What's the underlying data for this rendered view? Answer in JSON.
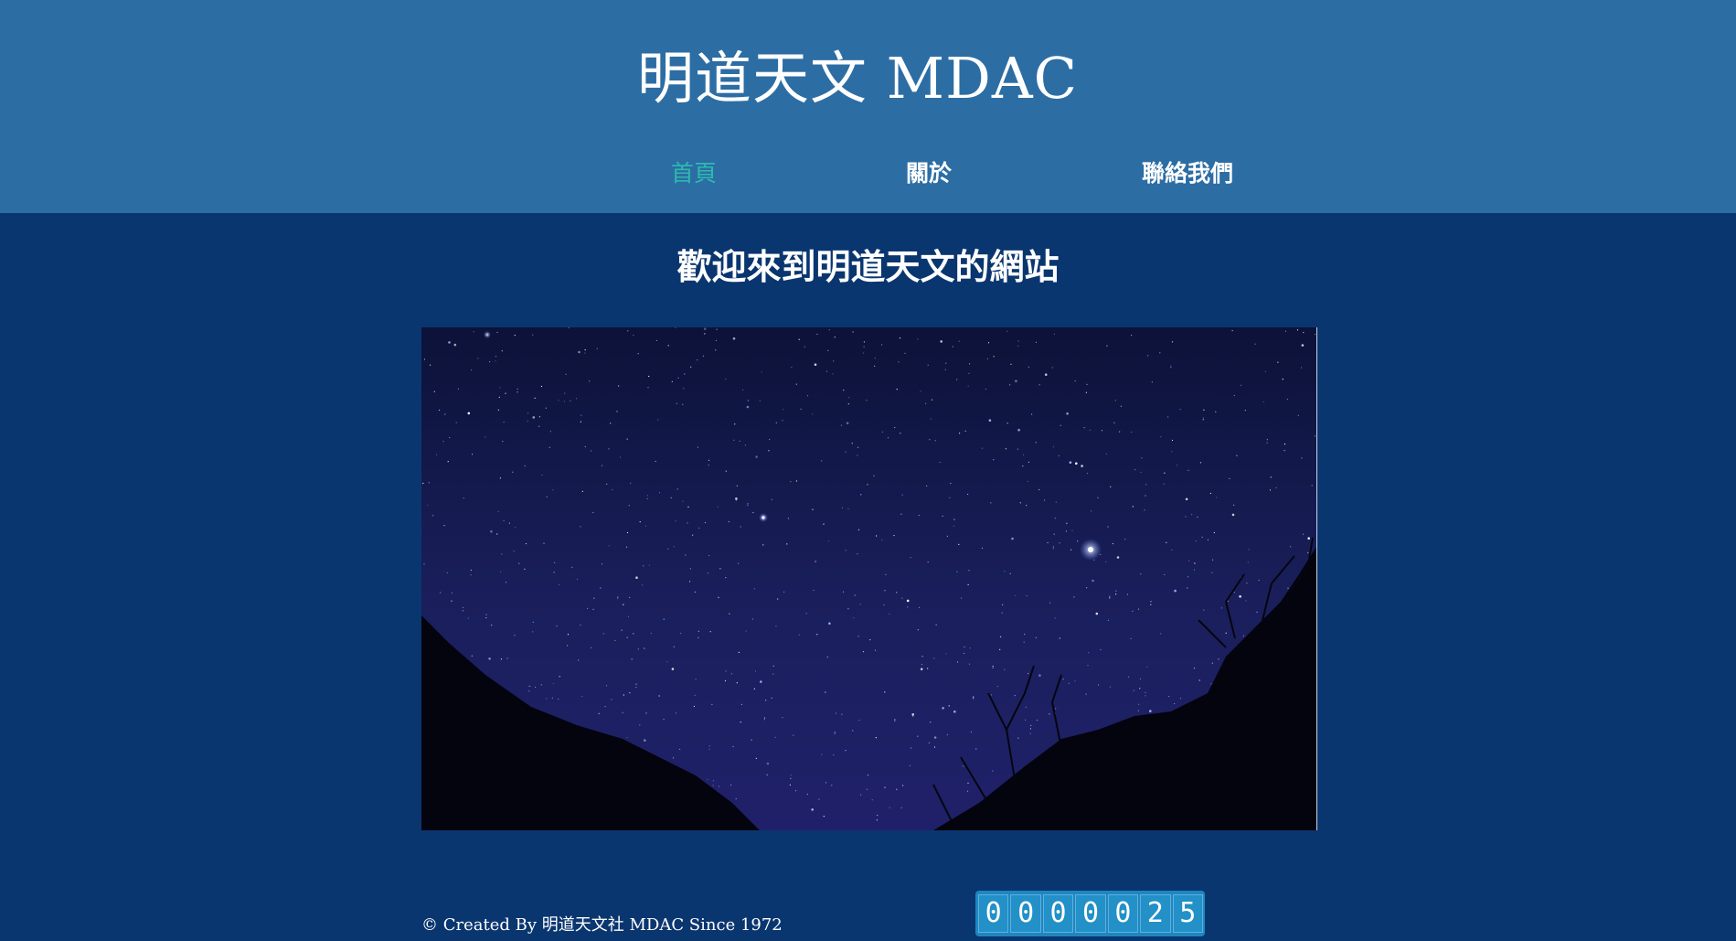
{
  "header": {
    "title": "明道天文 MDAC"
  },
  "nav": {
    "items": [
      {
        "label": "首頁",
        "active": true
      },
      {
        "label": "關於",
        "active": false
      },
      {
        "label": "聯絡我們",
        "active": false
      }
    ]
  },
  "main": {
    "welcome": "歡迎來到明道天文的網站"
  },
  "footer": {
    "copyright": "© Created By 明道天文社 MDAC Since 1972"
  },
  "counter": {
    "digits": [
      "0",
      "0",
      "0",
      "0",
      "0",
      "2",
      "5"
    ]
  },
  "colors": {
    "header_bg": "#2c6da4",
    "page_bg": "#0a3670",
    "nav_active": "#2db9ad",
    "counter_bg": "#1f86bf"
  }
}
